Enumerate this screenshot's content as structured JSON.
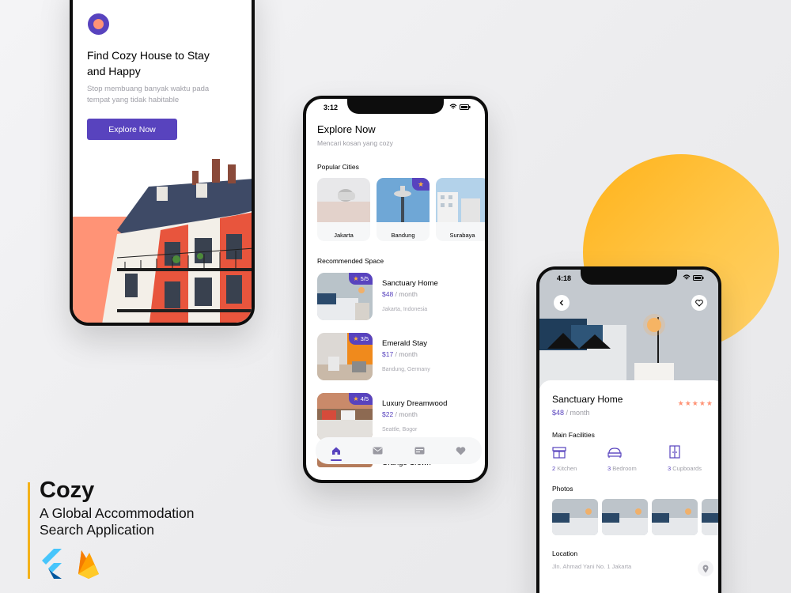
{
  "onboarding": {
    "title": "Find Cozy House to Stay and Happy",
    "subtitle": "Stop membuang banyak waktu pada tempat yang tidak habitable",
    "cta_label": "Explore Now"
  },
  "explore": {
    "status_time": "3:12",
    "title": "Explore Now",
    "subtitle": "Mencari kosan yang cozy",
    "popular_heading": "Popular Cities",
    "cities": [
      {
        "name": "Jakarta",
        "favorite": false
      },
      {
        "name": "Bandung",
        "favorite": true
      },
      {
        "name": "Surabaya",
        "favorite": false
      }
    ],
    "recommended_heading": "Recommended Space",
    "spaces": [
      {
        "name": "Sanctuary Home",
        "price": "$48",
        "per": " / month",
        "location": "Jakarta, Indonesia",
        "rating": "5/5"
      },
      {
        "name": "Emerald Stay",
        "price": "$17",
        "per": " / month",
        "location": "Bandung, Germany",
        "rating": "3/5"
      },
      {
        "name": "Luxury Dreamwood",
        "price": "$22",
        "per": " / month",
        "location": "Seattle, Bogor",
        "rating": "4/5"
      }
    ],
    "peek_item": "Orange Crown",
    "nav": [
      {
        "name": "home-icon",
        "active": true
      },
      {
        "name": "mail-icon",
        "active": false
      },
      {
        "name": "card-icon",
        "active": false
      },
      {
        "name": "heart-icon",
        "active": false
      }
    ]
  },
  "detail": {
    "status_time": "4:18",
    "name": "Sanctuary Home",
    "price": "$48",
    "per": " / month",
    "rating_stars": 5,
    "facilities_heading": "Main Facilities",
    "facilities": [
      {
        "count": "2",
        "label": " Kitchen",
        "icon": "kitchen-icon"
      },
      {
        "count": "3",
        "label": " Bedroom",
        "icon": "bed-icon"
      },
      {
        "count": "3",
        "label": " Cupboards",
        "icon": "cupboard-icon"
      }
    ],
    "photos_heading": "Photos",
    "location_heading": "Location",
    "address": "Jln. Ahmad Yani No. 1 Jakarta"
  },
  "brand": {
    "name": "Cozy",
    "tagline": "A Global Accommodation Search Application"
  },
  "colors": {
    "primary": "#5843BE",
    "accent": "#FF9376",
    "star": "#FFB23F",
    "circle": "#FFB21A"
  }
}
